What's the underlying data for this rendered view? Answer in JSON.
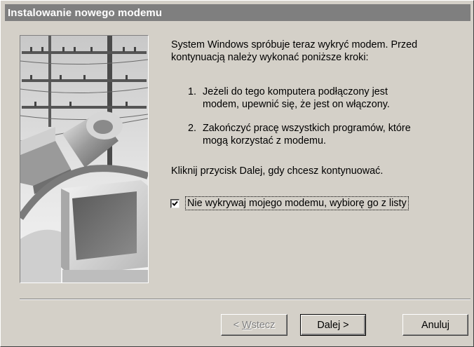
{
  "window": {
    "title": "Instalowanie nowego modemu"
  },
  "content": {
    "intro": [
      "System Windows spróbuje teraz wykryć modem. Przed",
      "kontynuacją należy wykonać poniższe kroki:"
    ],
    "steps": [
      {
        "number": "1.",
        "lines": [
          "Jeżeli do tego komputera podłączony jest",
          "modem, upewnić się, że jest on włączony."
        ]
      },
      {
        "number": "2.",
        "lines": [
          "Zakończyć pracę wszystkich programów, które",
          "mogą korzystać z modemu."
        ]
      }
    ],
    "instruction": "Kliknij przycisk Dalej, gdy chcesz kontynuować.",
    "checkbox": {
      "label": "Nie wykrywaj mojego modemu, wybiorę go z listy",
      "checked": true
    }
  },
  "buttons": {
    "back": {
      "prefix": "< ",
      "accel": "W",
      "rest": "stecz",
      "enabled": false
    },
    "next": {
      "label": "Dalej >"
    },
    "cancel": {
      "label": "Anuluj"
    }
  },
  "colors": {
    "titlebar": "#7f7f7f",
    "dialog_bg": "#d4d0c8"
  }
}
